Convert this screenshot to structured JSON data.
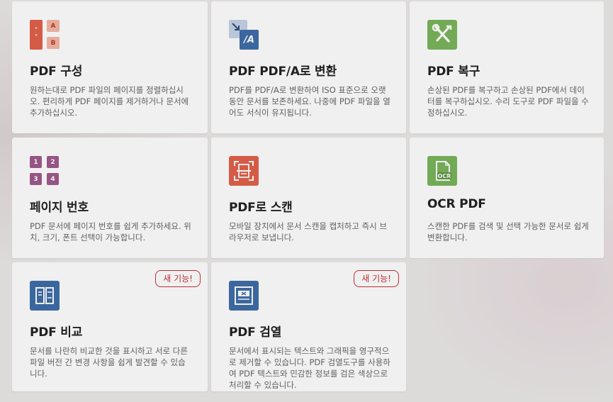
{
  "new_badge": "새 기능!",
  "tiles": [
    {
      "title": "PDF 구성",
      "desc": "원하는대로 PDF 파일의 페이지를 정렬하십시오. 편리하게 PDF 페이지를 제거하거나 문서에 추가하십시오.",
      "icon": "organize-pages-icon",
      "icon_letters": [
        "A",
        "B"
      ]
    },
    {
      "title": "PDF PDF/A로 변환",
      "desc": "PDF를 PDF/A로 변환하여 ISO 표준으로 오랫동안 문서를 보존하세요. 나중에 PDF 파일을 열어도 서식이 유지됩니다.",
      "icon": "pdfa-convert-icon",
      "icon_text": "/A"
    },
    {
      "title": "PDF 복구",
      "desc": "손상된 PDF를 복구하고 손상된 PDF에서 데이터를 복구하십시오. 수리 도구로 PDF 파일을 수정하십시오.",
      "icon": "repair-tools-icon"
    },
    {
      "title": "페이지 번호",
      "desc": "PDF 문서에 페이지 번호를 쉽게 추가하세요. 위치, 크기, 폰트 선택이 가능합니다.",
      "icon": "page-numbers-icon",
      "icon_numbers": [
        "1",
        "2",
        "3",
        "4"
      ]
    },
    {
      "title": "PDF로 스캔",
      "desc": "모바일 장치에서 문서 스캔을 캡처하고 즉시 브라우저로 보냅니다.",
      "icon": "scan-document-icon"
    },
    {
      "title": "OCR PDF",
      "desc": "스캔한 PDF를 검색 및 선택 가능한 문서로 쉽게 변환합니다.",
      "icon": "ocr-icon",
      "icon_text": "OCR"
    },
    {
      "title": "PDF 비교",
      "desc": "문서를 나란히 비교한 것을 표시하고 서로 다른 파일 버전 간 변경 사항을 쉽게 발견할 수 있습니다.",
      "icon": "compare-icon"
    },
    {
      "title": "PDF 검열",
      "desc": "문서에서 표시되는 텍스트와 그래픽을 영구적으로 제거할 수 있습니다. PDF 검열도구를 사용하여 PDF 텍스트와 민감한 정보를 검은 색상으로 처리할 수 있습니다.",
      "icon": "redact-icon"
    }
  ],
  "colors": {
    "organize": "#e2614a",
    "pdfa": "#3f6ea8",
    "repair": "#7ab55c",
    "numbers": "#a05a8e",
    "scan": "#e2614a",
    "ocr": "#7ab55c",
    "compare": "#3f6ea8",
    "redact": "#3f6ea8",
    "badge": "#c8333a"
  }
}
